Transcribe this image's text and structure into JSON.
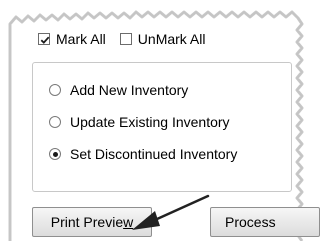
{
  "mark_all": {
    "label": "Mark All",
    "checked": true
  },
  "unmark_all": {
    "label": "UnMark All",
    "checked": false
  },
  "inventory_options": [
    {
      "label": "Add New Inventory",
      "selected": false
    },
    {
      "label": "Update Existing Inventory",
      "selected": false
    },
    {
      "label": "Set Discontinued Inventory",
      "selected": true
    }
  ],
  "buttons": {
    "print_preview_prefix": "Print Previe",
    "print_preview_mnemonic": "w",
    "process_label": "Process"
  },
  "colors": {
    "arrow": "#222222",
    "torn_edge_shadow": "#9a9a9a"
  }
}
